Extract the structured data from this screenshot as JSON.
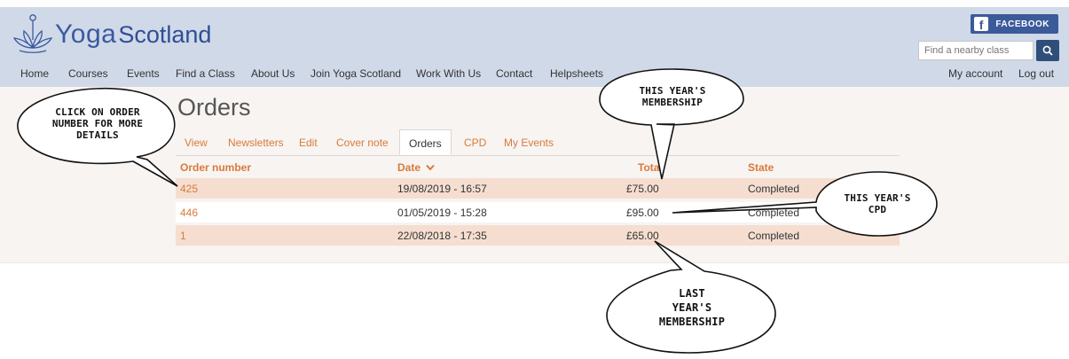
{
  "brand": {
    "yoga": "Yoga",
    "scotland": "Scotland",
    "logo_icon": "lotus-icon"
  },
  "facebook": {
    "label": "FACEBOOK",
    "icon": "facebook-icon"
  },
  "search": {
    "placeholder": "Find a nearby class",
    "icon": "search-icon"
  },
  "nav": {
    "items": [
      "Home",
      "Courses",
      "Events",
      "Find a Class",
      "About Us",
      "Join Yoga Scotland",
      "Work With Us",
      "Contact",
      "Helpsheets"
    ],
    "my_account": "My account",
    "log_out": "Log out"
  },
  "page": {
    "title": "Orders"
  },
  "tabs": [
    "View",
    "Newsletters",
    "Edit",
    "Cover note",
    "Orders",
    "CPD",
    "My Events"
  ],
  "active_tab": "Orders",
  "table": {
    "headers": {
      "order_number": "Order number",
      "date": "Date",
      "total": "Total",
      "state": "State"
    },
    "rows": [
      {
        "order": "425",
        "date": "19/08/2019 - 16:57",
        "total": "£75.00",
        "state": "Completed"
      },
      {
        "order": "446",
        "date": "01/05/2019 - 15:28",
        "total": "£95.00",
        "state": "Completed"
      },
      {
        "order": "1",
        "date": "22/08/2018 - 17:35",
        "total": "£65.00",
        "state": "Completed"
      }
    ]
  },
  "annotations": {
    "click": [
      "CLICK ON ORDER",
      "NUMBER FOR MORE",
      "DETAILS"
    ],
    "this_membership": [
      "THIS YEAR'S",
      "MEMBERSHIP"
    ],
    "this_cpd": [
      "THIS YEAR'S",
      "CPD"
    ],
    "last_membership": [
      "LAST",
      "YEAR'S",
      "MEMBERSHIP"
    ]
  },
  "colors": {
    "header_bg": "#d0d9e8",
    "accent": "#d97a3a",
    "row_highlight": "#f5ded0",
    "brand_blue": "#3a5aa0"
  }
}
